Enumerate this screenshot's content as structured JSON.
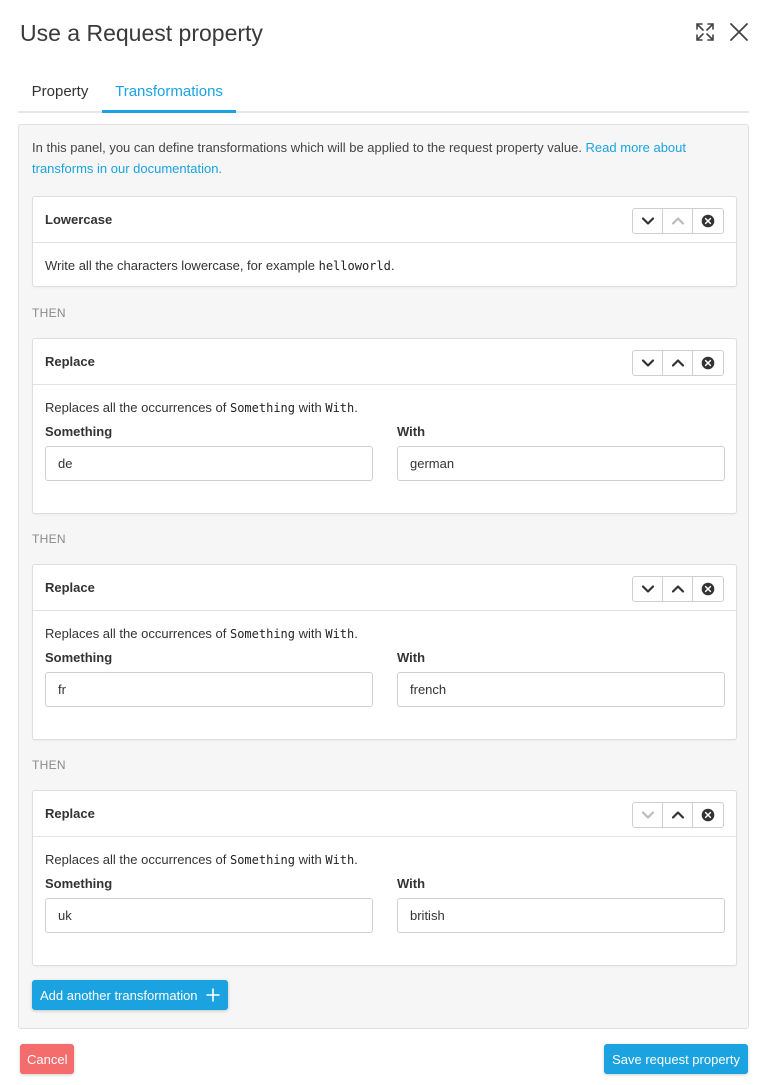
{
  "dialog": {
    "title": "Use a Request property",
    "expand_icon": "expand-icon",
    "close_icon": "close-icon"
  },
  "tabs": [
    {
      "label": "Property",
      "active": false
    },
    {
      "label": "Transformations",
      "active": true
    }
  ],
  "intro": {
    "text": "In this panel, you can define transformations which will be applied to the request property value. ",
    "link": "Read more about transforms in our documentation."
  },
  "separator_label": "THEN",
  "transformations": [
    {
      "title": "Lowercase",
      "desc_prefix": "Write all the characters lowercase, for example ",
      "desc_code": "helloworld",
      "desc_suffix": ".",
      "down_enabled": true,
      "up_enabled": false
    },
    {
      "title": "Replace",
      "desc_prefix": "Replaces all the occurrences of ",
      "desc_code1": "Something",
      "desc_mid": " with ",
      "desc_code2": "With",
      "desc_suffix": ".",
      "something_label": "Something",
      "something_value": "de",
      "with_label": "With",
      "with_value": "german",
      "down_enabled": true,
      "up_enabled": true
    },
    {
      "title": "Replace",
      "desc_prefix": "Replaces all the occurrences of ",
      "desc_code1": "Something",
      "desc_mid": " with ",
      "desc_code2": "With",
      "desc_suffix": ".",
      "something_label": "Something",
      "something_value": "fr",
      "with_label": "With",
      "with_value": "french",
      "down_enabled": true,
      "up_enabled": true
    },
    {
      "title": "Replace",
      "desc_prefix": "Replaces all the occurrences of ",
      "desc_code1": "Something",
      "desc_mid": " with ",
      "desc_code2": "With",
      "desc_suffix": ".",
      "something_label": "Something",
      "something_value": "uk",
      "with_label": "With",
      "with_value": "british",
      "down_enabled": false,
      "up_enabled": true
    }
  ],
  "actions": {
    "add_label": "Add another transformation",
    "cancel_label": "Cancel",
    "save_label": "Save request property"
  },
  "colors": {
    "accent": "#1aa3e0",
    "danger": "#f46c6c",
    "icon_enabled": "#333333",
    "icon_disabled": "#bbbbbb"
  }
}
